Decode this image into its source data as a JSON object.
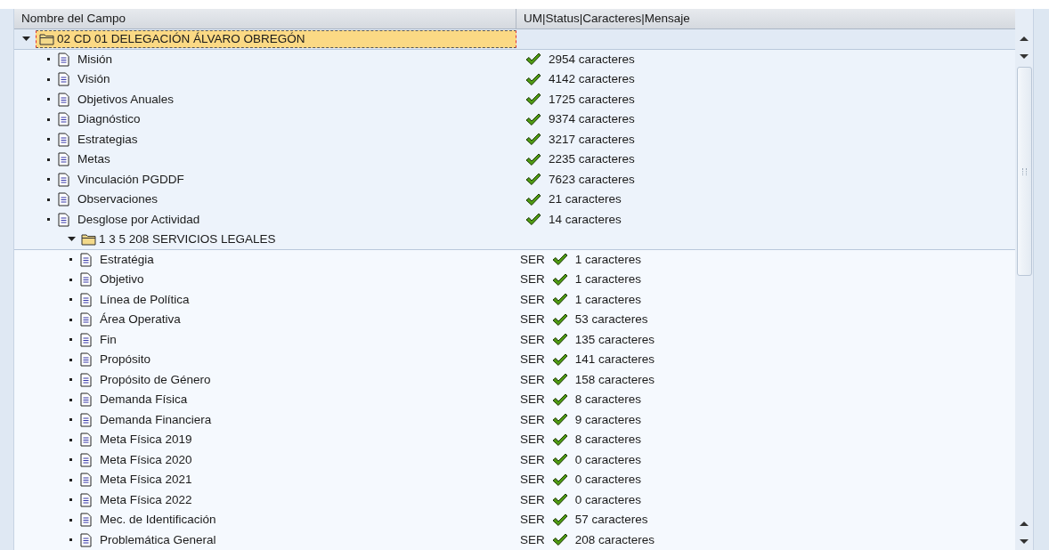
{
  "columns": [
    "Nombre del Campo",
    "UM|Status|Caracteres|Mensaje"
  ],
  "tree": {
    "label": "02 CD 01 DELEGACIÓN ÁLVARO OBREGÓN",
    "expanded": true,
    "selected": true,
    "children": [
      {
        "kind": "leaf",
        "label": "Misión",
        "valid": true,
        "chars": "2954 caracteres"
      },
      {
        "kind": "leaf",
        "label": "Visión",
        "valid": true,
        "chars": "4142 caracteres"
      },
      {
        "kind": "leaf",
        "label": "Objetivos Anuales",
        "valid": true,
        "chars": "1725 caracteres"
      },
      {
        "kind": "leaf",
        "label": "Diagnóstico",
        "valid": true,
        "chars": "9374 caracteres"
      },
      {
        "kind": "leaf",
        "label": "Estrategias",
        "valid": true,
        "chars": "3217 caracteres"
      },
      {
        "kind": "leaf",
        "label": "Metas",
        "valid": true,
        "chars": "2235 caracteres"
      },
      {
        "kind": "leaf",
        "label": "Vinculación PGDDF",
        "valid": true,
        "chars": "7623 caracteres"
      },
      {
        "kind": "leaf",
        "label": "Observaciones",
        "valid": true,
        "chars": "21 caracteres"
      },
      {
        "kind": "leaf",
        "label": "Desglose por Actividad",
        "valid": true,
        "chars": "14 caracteres"
      },
      {
        "kind": "folder",
        "label": "1 3 5 208 SERVICIOS LEGALES",
        "expanded": true,
        "selected": false,
        "children": [
          {
            "kind": "leaf",
            "label": "Estratégia",
            "um": "SER",
            "valid": true,
            "chars": "1 caracteres"
          },
          {
            "kind": "leaf",
            "label": "Objetivo",
            "um": "SER",
            "valid": true,
            "chars": "1 caracteres"
          },
          {
            "kind": "leaf",
            "label": "Línea de Política",
            "um": "SER",
            "valid": true,
            "chars": "1 caracteres"
          },
          {
            "kind": "leaf",
            "label": "Área Operativa",
            "um": "SER",
            "valid": true,
            "chars": "53 caracteres"
          },
          {
            "kind": "leaf",
            "label": "Fin",
            "um": "SER",
            "valid": true,
            "chars": "135 caracteres"
          },
          {
            "kind": "leaf",
            "label": "Propósito",
            "um": "SER",
            "valid": true,
            "chars": "141 caracteres"
          },
          {
            "kind": "leaf",
            "label": "Propósito de Género",
            "um": "SER",
            "valid": true,
            "chars": "158 caracteres"
          },
          {
            "kind": "leaf",
            "label": "Demanda Física",
            "um": "SER",
            "valid": true,
            "chars": "8 caracteres"
          },
          {
            "kind": "leaf",
            "label": "Demanda Financiera",
            "um": "SER",
            "valid": true,
            "chars": "9 caracteres"
          },
          {
            "kind": "leaf",
            "label": "Meta Física 2019",
            "um": "SER",
            "valid": true,
            "chars": "8 caracteres"
          },
          {
            "kind": "leaf",
            "label": "Meta Física 2020",
            "um": "SER",
            "valid": true,
            "chars": "0 caracteres"
          },
          {
            "kind": "leaf",
            "label": "Meta Física 2021",
            "um": "SER",
            "valid": true,
            "chars": "0 caracteres"
          },
          {
            "kind": "leaf",
            "label": "Meta Física 2022",
            "um": "SER",
            "valid": true,
            "chars": "0 caracteres"
          },
          {
            "kind": "leaf",
            "label": "Mec. de Identificación",
            "um": "SER",
            "valid": true,
            "chars": "57 caracteres"
          },
          {
            "kind": "leaf",
            "label": "Problemática General",
            "um": "SER",
            "valid": true,
            "chars": "208 caracteres"
          }
        ]
      }
    ]
  }
}
